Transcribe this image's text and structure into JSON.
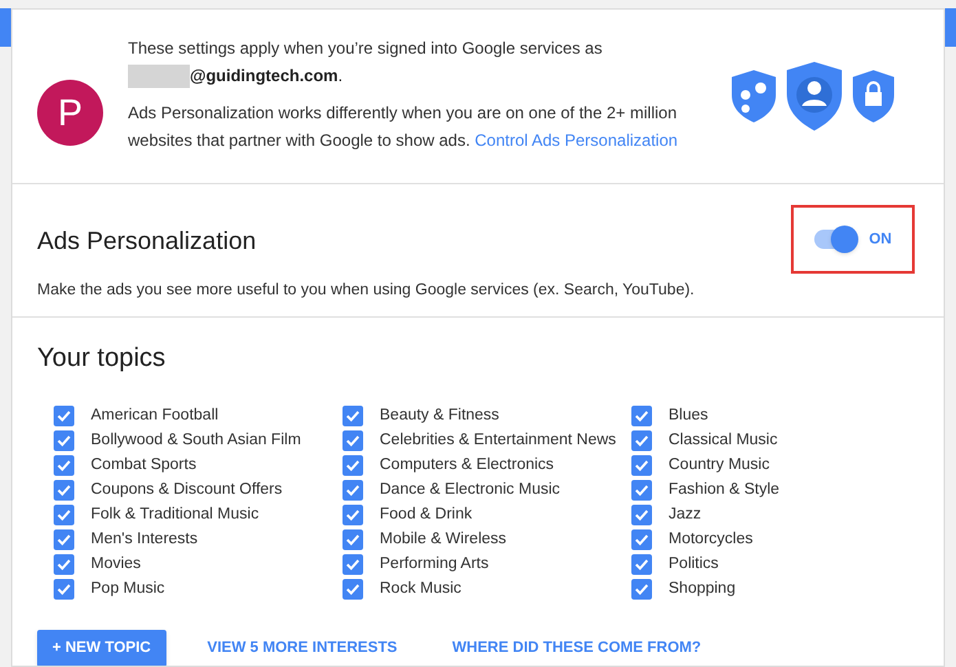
{
  "account": {
    "avatar_letter": "P",
    "intro": "These settings apply when you’re signed into Google services as",
    "email": "**@guidingtech.com**.",
    "email_redacted": true,
    "info": "Ads Personalization works differently when you are on one of the 2+ million websites that partner with Google to show ads.",
    "link": "Control Ads Personalization"
  },
  "ads_personalization": {
    "title": "Ads Personalization",
    "toggle": {
      "on": true,
      "label": "ON",
      "highlighted": true
    },
    "description": "Make the ads you see more useful to you when using Google services (ex. Search, YouTube)."
  },
  "topics": {
    "title": "Your topics",
    "columns": [
      [
        {
          "label": "American Football",
          "checked": true
        },
        {
          "label": "Bollywood & South Asian Film",
          "checked": true
        },
        {
          "label": "Combat Sports",
          "checked": true
        },
        {
          "label": "Coupons & Discount Offers",
          "checked": true
        },
        {
          "label": "Folk & Traditional Music",
          "checked": true
        },
        {
          "label": "Men's Interests",
          "checked": true
        },
        {
          "label": "Movies",
          "checked": true
        },
        {
          "label": "Pop Music",
          "checked": true
        }
      ],
      [
        {
          "label": "Beauty & Fitness",
          "checked": true
        },
        {
          "label": "Celebrities & Entertainment News",
          "checked": true
        },
        {
          "label": "Computers & Electronics",
          "checked": true
        },
        {
          "label": "Dance & Electronic Music",
          "checked": true
        },
        {
          "label": "Food & Drink",
          "checked": true
        },
        {
          "label": "Mobile & Wireless",
          "checked": true
        },
        {
          "label": "Performing Arts",
          "checked": true
        },
        {
          "label": "Rock Music",
          "checked": true
        }
      ],
      [
        {
          "label": "Blues",
          "checked": true
        },
        {
          "label": "Classical Music",
          "checked": true
        },
        {
          "label": "Country Music",
          "checked": true
        },
        {
          "label": "Fashion & Style",
          "checked": true
        },
        {
          "label": "Jazz",
          "checked": true
        },
        {
          "label": "Motorcycles",
          "checked": true
        },
        {
          "label": "Politics",
          "checked": true
        },
        {
          "label": "Shopping",
          "checked": true
        }
      ]
    ],
    "new_topic_button": "+ NEW TOPIC",
    "links": [
      "VIEW 5 MORE INTERESTS",
      "WHERE DID THESE COME FROM?"
    ]
  }
}
